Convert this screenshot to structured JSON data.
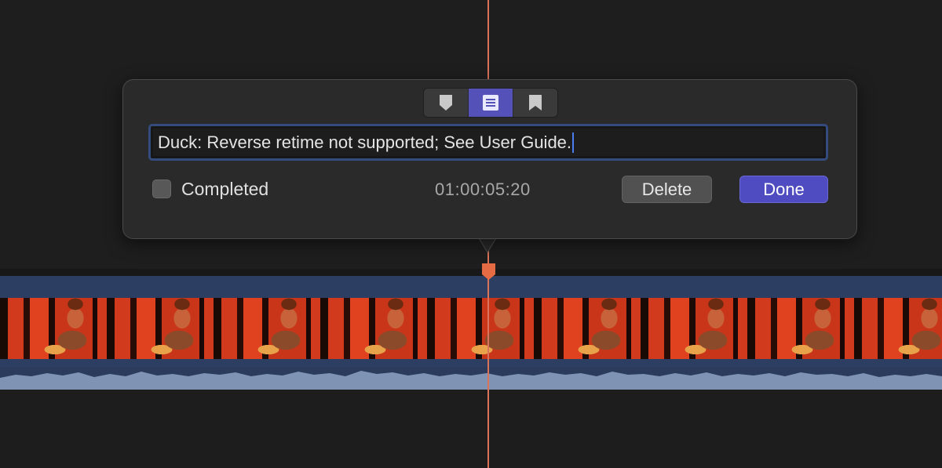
{
  "popover": {
    "tabs": [
      {
        "icon": "standard-marker-icon",
        "active": false
      },
      {
        "icon": "todo-list-icon",
        "active": true
      },
      {
        "icon": "chapter-marker-icon",
        "active": false
      }
    ],
    "note_value": "Duck: Reverse retime not supported; See User Guide.",
    "completed_label": "Completed",
    "completed_checked": false,
    "timecode": "01:00:05:20",
    "delete_label": "Delete",
    "done_label": "Done"
  },
  "colors": {
    "accent": "#5451b8",
    "clip_header": "#2c3f62",
    "playhead": "#d9735b",
    "marker": "#e56b45"
  }
}
